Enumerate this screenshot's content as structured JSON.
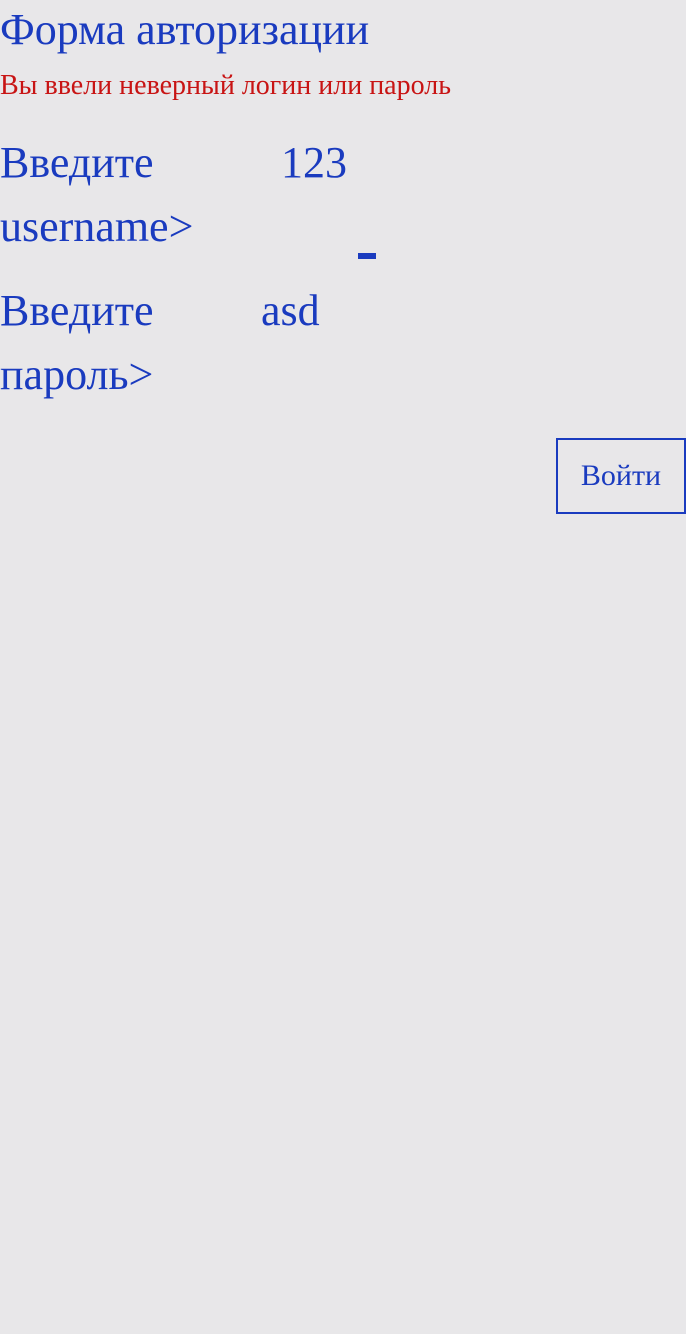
{
  "form": {
    "title": "Форма авторизации",
    "error_message": "Вы ввели неверный логин или пароль",
    "login": {
      "label_line1": "Введите",
      "label_line2": "username>",
      "value": "123"
    },
    "password": {
      "label_line1": "Введите",
      "label_line2": "пароль>",
      "value": "asd"
    },
    "submit_label": "Войти"
  },
  "colors": {
    "background": "#e8e7e9",
    "primary": "#1a3bbf",
    "error": "#c81414"
  }
}
